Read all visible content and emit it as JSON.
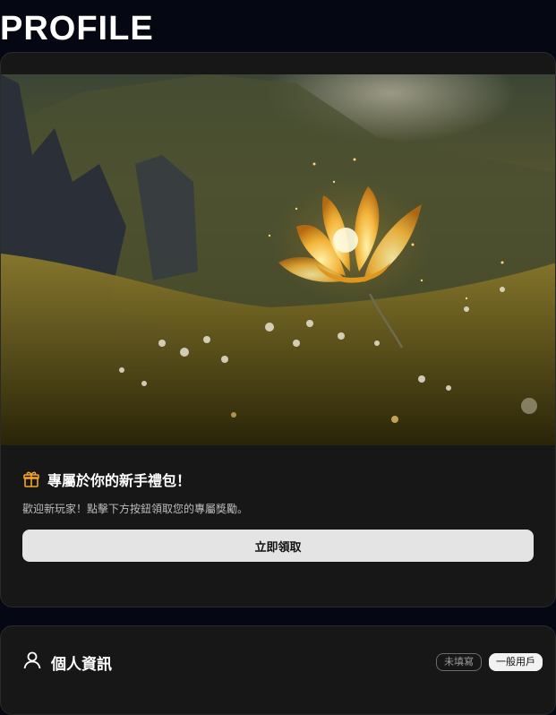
{
  "page": {
    "title": "PROFILE"
  },
  "gift": {
    "icon": "gift-icon",
    "title": "專屬於你的新手禮包！",
    "description": "歡迎新玩家！點擊下方按鈕領取您的專屬獎勵。",
    "claim_label": "立即領取",
    "accent_color": "#f5a623"
  },
  "profile": {
    "icon": "user-icon",
    "title": "個人資訊",
    "badges": {
      "status": "未填寫",
      "role": "一般用戶"
    }
  }
}
